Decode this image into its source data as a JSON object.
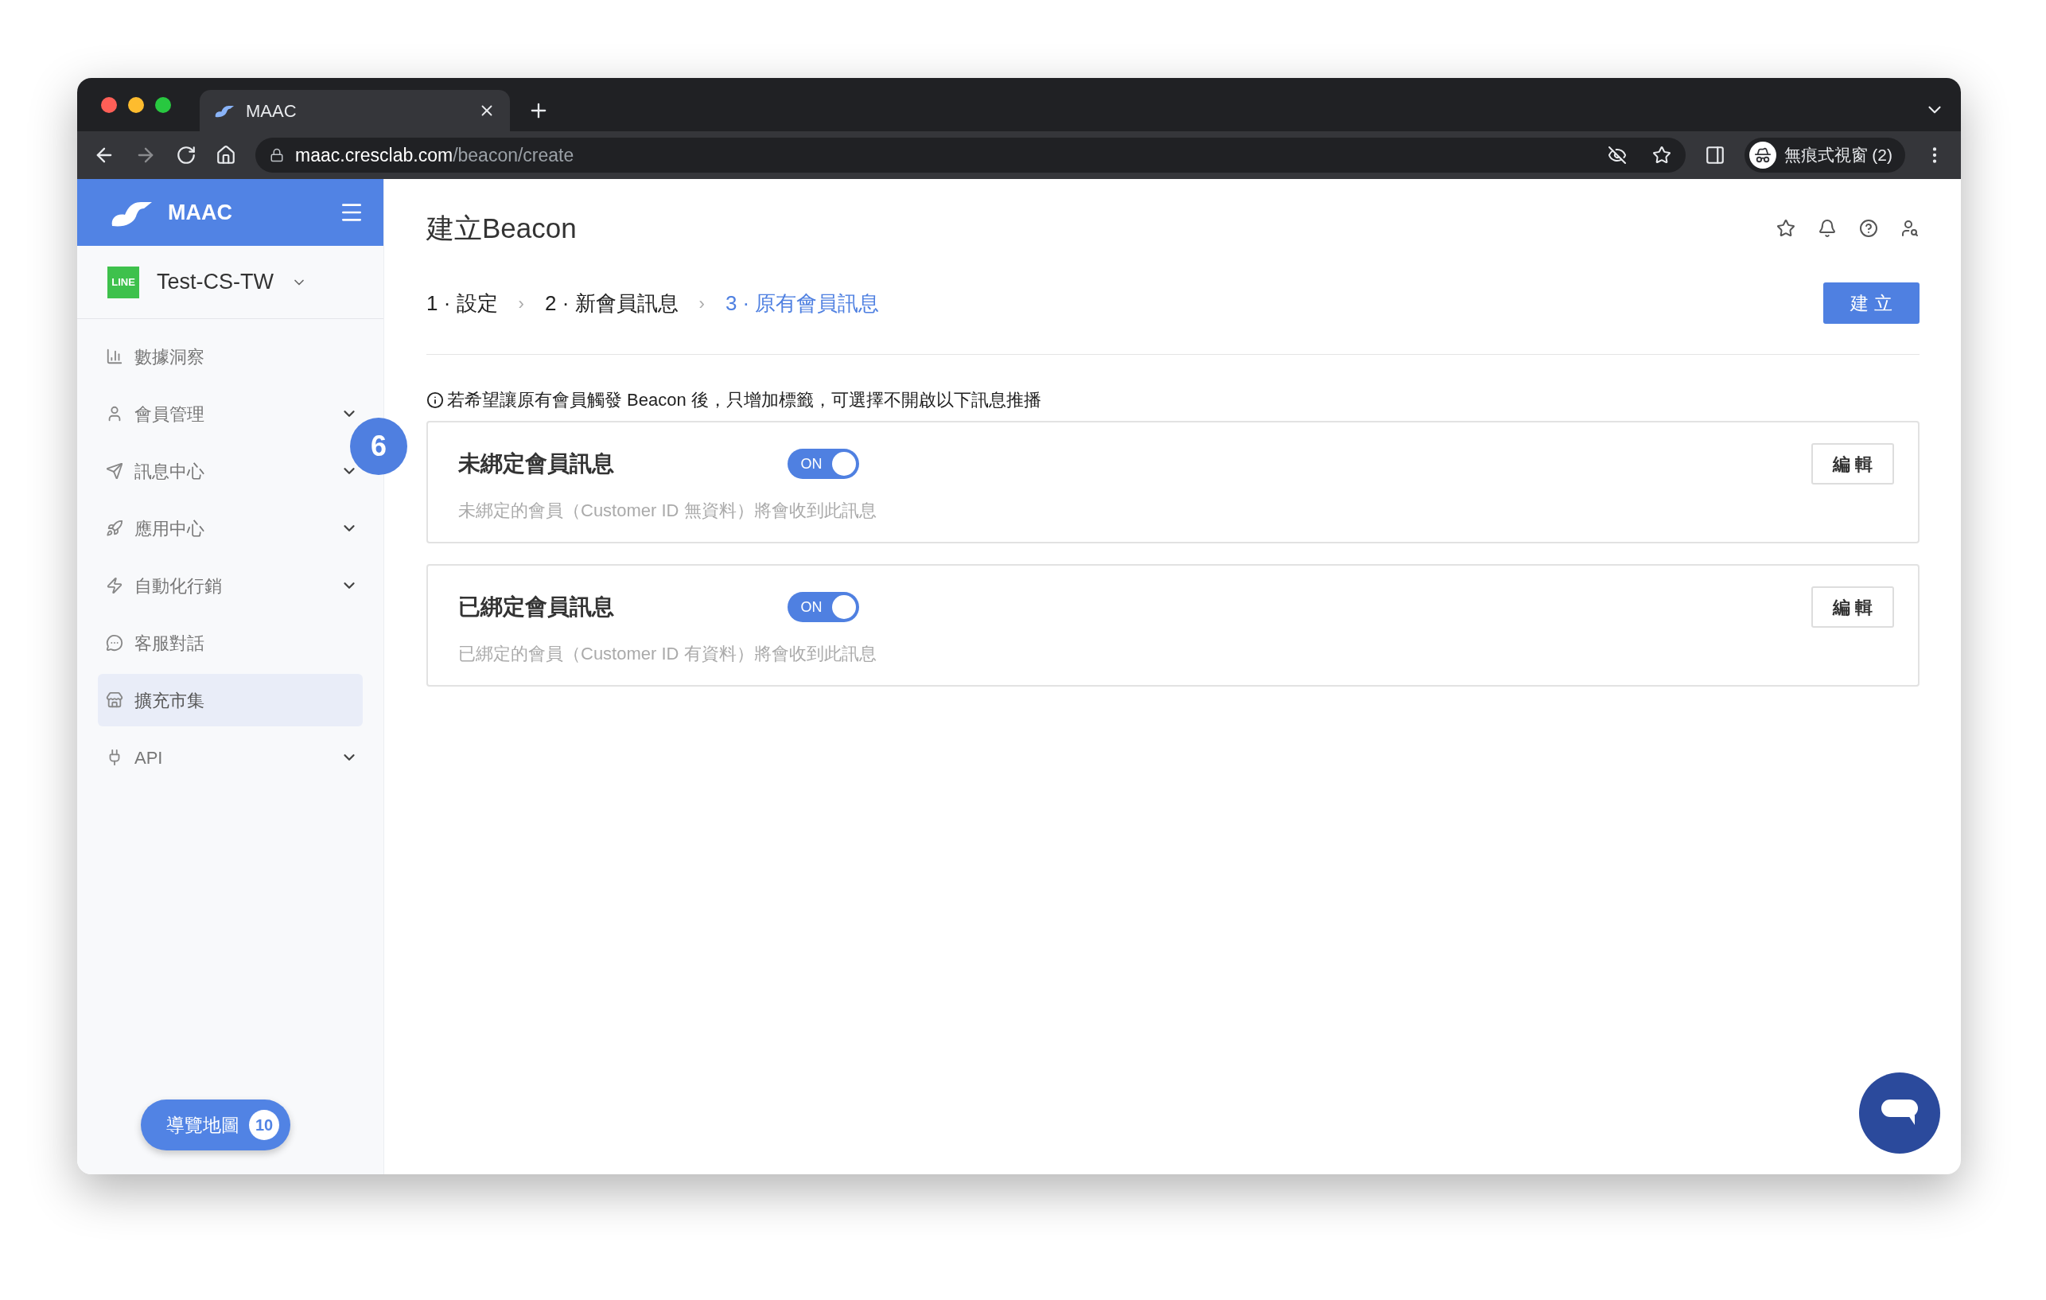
{
  "browser": {
    "tab_title": "MAAC",
    "url_host": "maac.cresclab.com",
    "url_path": "/beacon/create",
    "profile_label": "無痕式視窗 (2)"
  },
  "sidebar": {
    "brand": "MAAC",
    "account": {
      "badge": "LINE",
      "name": "Test-CS-TW"
    },
    "items": [
      {
        "label": "數據洞察",
        "kind": "chart",
        "expandable": false,
        "selected": false
      },
      {
        "label": "會員管理",
        "kind": "user",
        "expandable": true,
        "selected": false
      },
      {
        "label": "訊息中心",
        "kind": "send",
        "expandable": true,
        "selected": false
      },
      {
        "label": "應用中心",
        "kind": "rocket",
        "expandable": true,
        "selected": false
      },
      {
        "label": "自動化行銷",
        "kind": "bolt",
        "expandable": true,
        "selected": false
      },
      {
        "label": "客服對話",
        "kind": "chat",
        "expandable": false,
        "selected": false
      },
      {
        "label": "擴充市集",
        "kind": "store",
        "expandable": false,
        "selected": true
      },
      {
        "label": "API",
        "kind": "plug",
        "expandable": true,
        "selected": false
      }
    ],
    "tour_button": {
      "label": "導覽地圖",
      "count": "10"
    }
  },
  "step_badge": "6",
  "page": {
    "title": "建立Beacon",
    "steps": [
      {
        "number": "1",
        "dot": "·",
        "label": "設定",
        "selected": false
      },
      {
        "arrow": "›",
        "number": "2",
        "dot": "·",
        "label": "新會員訊息",
        "selected": false
      },
      {
        "arrow": "›",
        "number": "3",
        "dot": "·",
        "label": "原有會員訊息",
        "selected": true
      }
    ],
    "create_button": "建 立",
    "notice": "若希望讓原有會員觸發 Beacon 後，只增加標籤，可選擇不開啟以下訊息推播",
    "cards": [
      {
        "title": "未綁定會員訊息",
        "toggle_label": "ON",
        "on": true,
        "edit_button": "編 輯",
        "description": "未綁定的會員（Customer ID 無資料）將會收到此訊息"
      },
      {
        "title": "已綁定會員訊息",
        "toggle_label": "ON",
        "on": true,
        "edit_button": "編 輯",
        "description": "已綁定的會員（Customer ID 有資料）將會收到此訊息"
      }
    ]
  }
}
